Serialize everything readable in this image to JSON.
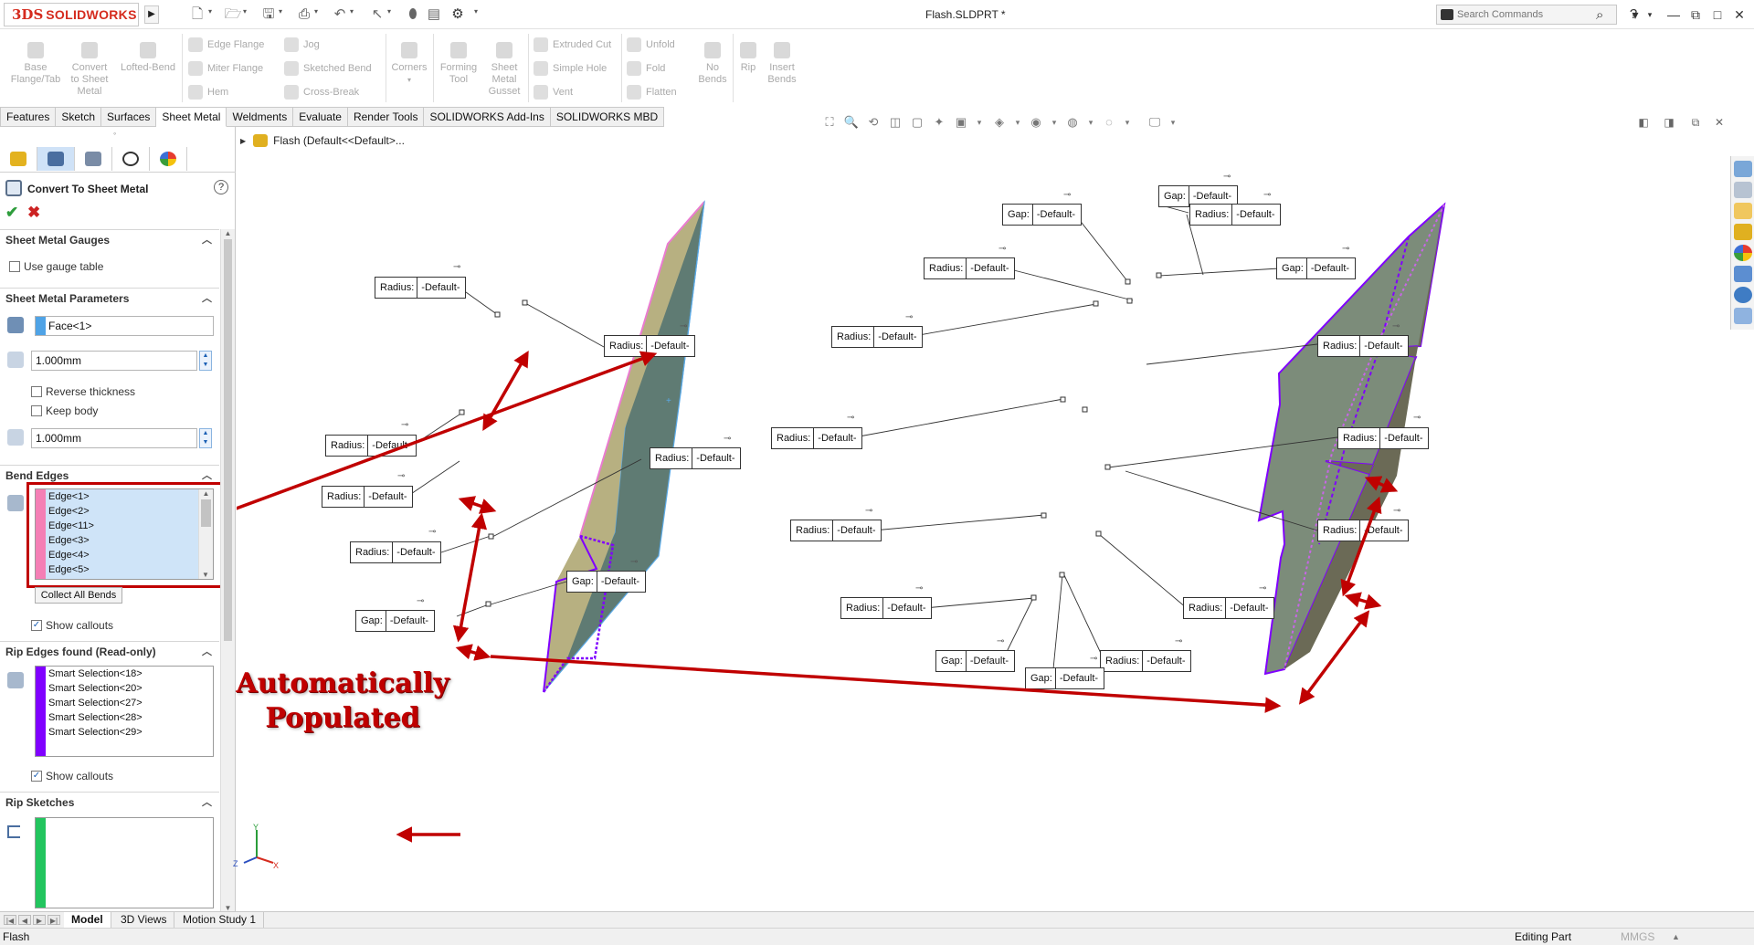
{
  "app": {
    "logo_ds": "3DS",
    "logo_text": "SOLIDWORKS",
    "document_title": "Flash.SLDPRT *",
    "search_placeholder": "Search Commands",
    "help": "?"
  },
  "commands": {
    "base_flange": [
      "Base",
      "Flange/Tab"
    ],
    "convert": [
      "Convert",
      "to Sheet",
      "Metal"
    ],
    "lofted_bend": "Lofted-Bend",
    "edge_flange": "Edge Flange",
    "miter_flange": "Miter Flange",
    "hem": "Hem",
    "jog": "Jog",
    "sketched_bend": "Sketched Bend",
    "cross_break": "Cross-Break",
    "corners": "Corners",
    "forming_tool": [
      "Forming",
      "Tool"
    ],
    "sheet_metal_gusset": [
      "Sheet",
      "Metal",
      "Gusset"
    ],
    "extruded_cut": "Extruded Cut",
    "simple_hole": "Simple Hole",
    "vent": "Vent",
    "unfold": "Unfold",
    "fold": "Fold",
    "flatten": "Flatten",
    "no_bends": [
      "No",
      "Bends"
    ],
    "rip": "Rip",
    "insert_bends": [
      "Insert",
      "Bends"
    ]
  },
  "tabs": [
    "Features",
    "Sketch",
    "Surfaces",
    "Sheet Metal",
    "Weldments",
    "Evaluate",
    "Render Tools",
    "SOLIDWORKS Add-Ins",
    "SOLIDWORKS MBD"
  ],
  "active_tab": "Sheet Metal",
  "property_manager": {
    "title": "Convert To Sheet Metal",
    "gauges": {
      "header": "Sheet Metal Gauges",
      "use_gauge_table": "Use gauge table"
    },
    "parameters": {
      "header": "Sheet Metal Parameters",
      "face": "Face<1>",
      "thickness": "1.000mm",
      "reverse_thickness": "Reverse thickness",
      "keep_body": "Keep body",
      "radius": "1.000mm"
    },
    "bend_edges": {
      "header": "Bend Edges",
      "items": [
        "Edge<1>",
        "Edge<2>",
        "Edge<11>",
        "Edge<3>",
        "Edge<4>",
        "Edge<5>"
      ],
      "collect_all": "Collect All Bends",
      "show_callouts": "Show callouts"
    },
    "rip_edges": {
      "header": "Rip Edges found (Read-only)",
      "items": [
        "Smart Selection<18>",
        "Smart Selection<20>",
        "Smart Selection<27>",
        "Smart Selection<28>",
        "Smart Selection<29>"
      ],
      "show_callouts": "Show callouts"
    },
    "rip_sketches": {
      "header": "Rip Sketches"
    }
  },
  "tree": {
    "node": "Flash  (Default<<Default>..."
  },
  "annotation": {
    "line1": "Automatically",
    "line2": "Populated"
  },
  "callouts": {
    "radius_label": "Radius:",
    "gap_label": "Gap:",
    "default_value": "-Default-"
  },
  "bottom_tabs": [
    "Model",
    "3D Views",
    "Motion Study 1"
  ],
  "status": {
    "left": "Flash",
    "mode": "Editing Part",
    "units": "MMGS"
  },
  "colors": {
    "brand_red": "#d52b1e",
    "bend_edges_bar": "#f47fb5",
    "rip_edges_bar": "#8000ff",
    "rip_sketch_bar": "#22c55e",
    "annotation_red": "#c00000"
  }
}
